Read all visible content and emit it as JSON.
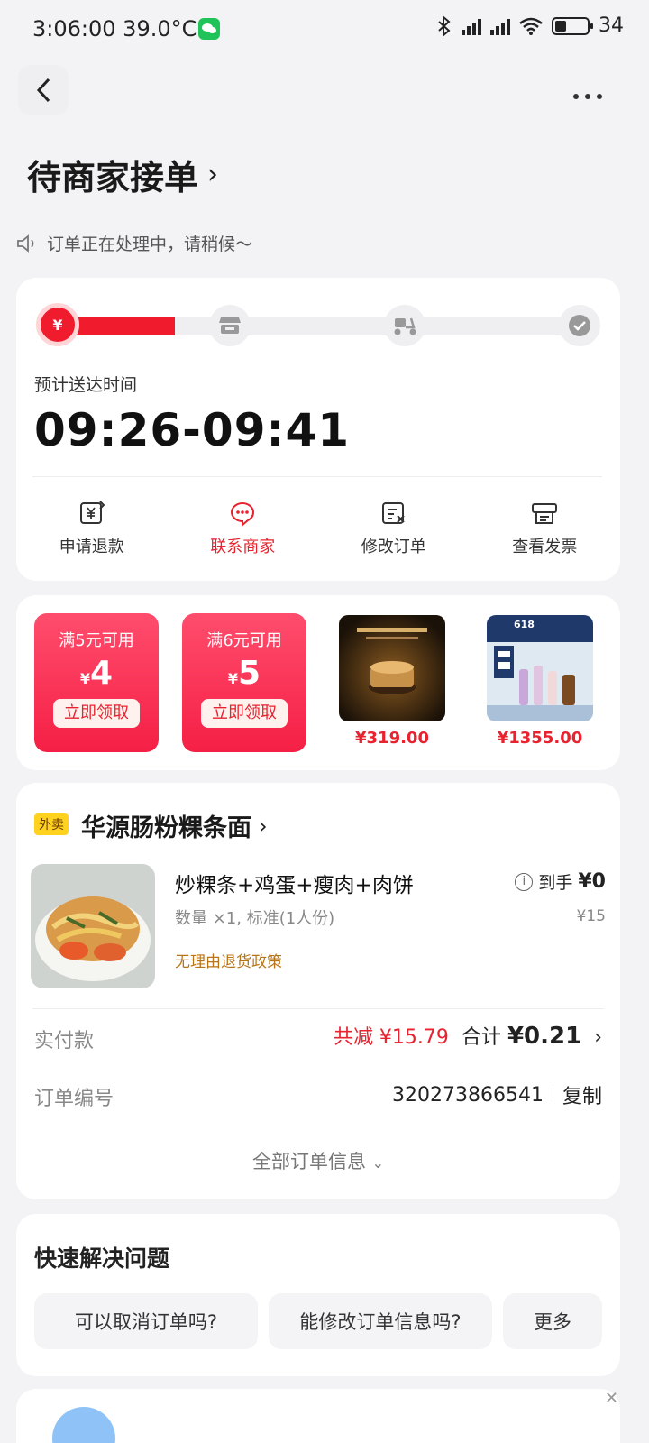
{
  "status_bar": {
    "time": "3:06:00",
    "temp": "39.0°C",
    "battery": "34"
  },
  "header": {
    "title": "待商家接单",
    "title_chevron": "›"
  },
  "notice": {
    "text": "订单正在处理中，请稍候～"
  },
  "progress": {
    "step_pay_icon": "¥",
    "steps_icons": [
      "store-icon",
      "scooter-icon",
      "check-icon"
    ],
    "eta_label": "预计送达时间",
    "eta_value": "09:26-09:41",
    "actions": [
      {
        "label": "申请退款",
        "icon": "refund-icon"
      },
      {
        "label": "联系商家",
        "icon": "chat-icon"
      },
      {
        "label": "修改订单",
        "icon": "edit-order-icon"
      },
      {
        "label": "查看发票",
        "icon": "invoice-icon"
      }
    ]
  },
  "promos": {
    "coupons": [
      {
        "condition": "满5元可用",
        "currency": "¥",
        "amount": "4",
        "claim": "立即领取"
      },
      {
        "condition": "满6元可用",
        "currency": "¥",
        "amount": "5",
        "claim": "立即领取"
      }
    ],
    "products": [
      {
        "price": "¥319.00"
      },
      {
        "price": "¥1355.00",
        "badge": "618"
      }
    ]
  },
  "order": {
    "tag": "外卖",
    "store": "华源肠粉粿条面",
    "item": {
      "name": "炒粿条+鸡蛋+瘦肉+肉饼",
      "spec": "数量 ×1, 标准(1人份)",
      "policy": "无理由退货政策",
      "net_label": "到手",
      "net_value": "¥0",
      "original": "¥15"
    },
    "pay_label": "实付款",
    "discount": "共减 ¥15.79",
    "total_label": "合计",
    "total_value": "¥0.21",
    "order_no_label": "订单编号",
    "order_no": "320273866541",
    "copy": "复制",
    "all_info": "全部订单信息"
  },
  "quick_help": {
    "title": "快速解决问题",
    "questions": [
      "可以取消订单吗?",
      "能修改订单信息吗?",
      "更多"
    ]
  },
  "close": "✕"
}
